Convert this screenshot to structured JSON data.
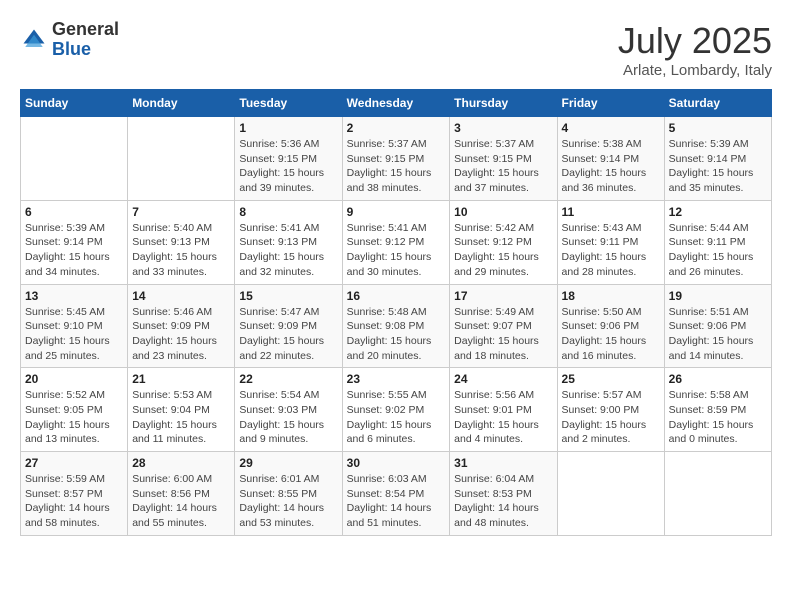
{
  "header": {
    "logo_general": "General",
    "logo_blue": "Blue",
    "month": "July 2025",
    "location": "Arlate, Lombardy, Italy"
  },
  "days_of_week": [
    "Sunday",
    "Monday",
    "Tuesday",
    "Wednesday",
    "Thursday",
    "Friday",
    "Saturday"
  ],
  "weeks": [
    [
      {
        "day": "",
        "detail": ""
      },
      {
        "day": "",
        "detail": ""
      },
      {
        "day": "1",
        "detail": "Sunrise: 5:36 AM\nSunset: 9:15 PM\nDaylight: 15 hours\nand 39 minutes."
      },
      {
        "day": "2",
        "detail": "Sunrise: 5:37 AM\nSunset: 9:15 PM\nDaylight: 15 hours\nand 38 minutes."
      },
      {
        "day": "3",
        "detail": "Sunrise: 5:37 AM\nSunset: 9:15 PM\nDaylight: 15 hours\nand 37 minutes."
      },
      {
        "day": "4",
        "detail": "Sunrise: 5:38 AM\nSunset: 9:14 PM\nDaylight: 15 hours\nand 36 minutes."
      },
      {
        "day": "5",
        "detail": "Sunrise: 5:39 AM\nSunset: 9:14 PM\nDaylight: 15 hours\nand 35 minutes."
      }
    ],
    [
      {
        "day": "6",
        "detail": "Sunrise: 5:39 AM\nSunset: 9:14 PM\nDaylight: 15 hours\nand 34 minutes."
      },
      {
        "day": "7",
        "detail": "Sunrise: 5:40 AM\nSunset: 9:13 PM\nDaylight: 15 hours\nand 33 minutes."
      },
      {
        "day": "8",
        "detail": "Sunrise: 5:41 AM\nSunset: 9:13 PM\nDaylight: 15 hours\nand 32 minutes."
      },
      {
        "day": "9",
        "detail": "Sunrise: 5:41 AM\nSunset: 9:12 PM\nDaylight: 15 hours\nand 30 minutes."
      },
      {
        "day": "10",
        "detail": "Sunrise: 5:42 AM\nSunset: 9:12 PM\nDaylight: 15 hours\nand 29 minutes."
      },
      {
        "day": "11",
        "detail": "Sunrise: 5:43 AM\nSunset: 9:11 PM\nDaylight: 15 hours\nand 28 minutes."
      },
      {
        "day": "12",
        "detail": "Sunrise: 5:44 AM\nSunset: 9:11 PM\nDaylight: 15 hours\nand 26 minutes."
      }
    ],
    [
      {
        "day": "13",
        "detail": "Sunrise: 5:45 AM\nSunset: 9:10 PM\nDaylight: 15 hours\nand 25 minutes."
      },
      {
        "day": "14",
        "detail": "Sunrise: 5:46 AM\nSunset: 9:09 PM\nDaylight: 15 hours\nand 23 minutes."
      },
      {
        "day": "15",
        "detail": "Sunrise: 5:47 AM\nSunset: 9:09 PM\nDaylight: 15 hours\nand 22 minutes."
      },
      {
        "day": "16",
        "detail": "Sunrise: 5:48 AM\nSunset: 9:08 PM\nDaylight: 15 hours\nand 20 minutes."
      },
      {
        "day": "17",
        "detail": "Sunrise: 5:49 AM\nSunset: 9:07 PM\nDaylight: 15 hours\nand 18 minutes."
      },
      {
        "day": "18",
        "detail": "Sunrise: 5:50 AM\nSunset: 9:06 PM\nDaylight: 15 hours\nand 16 minutes."
      },
      {
        "day": "19",
        "detail": "Sunrise: 5:51 AM\nSunset: 9:06 PM\nDaylight: 15 hours\nand 14 minutes."
      }
    ],
    [
      {
        "day": "20",
        "detail": "Sunrise: 5:52 AM\nSunset: 9:05 PM\nDaylight: 15 hours\nand 13 minutes."
      },
      {
        "day": "21",
        "detail": "Sunrise: 5:53 AM\nSunset: 9:04 PM\nDaylight: 15 hours\nand 11 minutes."
      },
      {
        "day": "22",
        "detail": "Sunrise: 5:54 AM\nSunset: 9:03 PM\nDaylight: 15 hours\nand 9 minutes."
      },
      {
        "day": "23",
        "detail": "Sunrise: 5:55 AM\nSunset: 9:02 PM\nDaylight: 15 hours\nand 6 minutes."
      },
      {
        "day": "24",
        "detail": "Sunrise: 5:56 AM\nSunset: 9:01 PM\nDaylight: 15 hours\nand 4 minutes."
      },
      {
        "day": "25",
        "detail": "Sunrise: 5:57 AM\nSunset: 9:00 PM\nDaylight: 15 hours\nand 2 minutes."
      },
      {
        "day": "26",
        "detail": "Sunrise: 5:58 AM\nSunset: 8:59 PM\nDaylight: 15 hours\nand 0 minutes."
      }
    ],
    [
      {
        "day": "27",
        "detail": "Sunrise: 5:59 AM\nSunset: 8:57 PM\nDaylight: 14 hours\nand 58 minutes."
      },
      {
        "day": "28",
        "detail": "Sunrise: 6:00 AM\nSunset: 8:56 PM\nDaylight: 14 hours\nand 55 minutes."
      },
      {
        "day": "29",
        "detail": "Sunrise: 6:01 AM\nSunset: 8:55 PM\nDaylight: 14 hours\nand 53 minutes."
      },
      {
        "day": "30",
        "detail": "Sunrise: 6:03 AM\nSunset: 8:54 PM\nDaylight: 14 hours\nand 51 minutes."
      },
      {
        "day": "31",
        "detail": "Sunrise: 6:04 AM\nSunset: 8:53 PM\nDaylight: 14 hours\nand 48 minutes."
      },
      {
        "day": "",
        "detail": ""
      },
      {
        "day": "",
        "detail": ""
      }
    ]
  ]
}
